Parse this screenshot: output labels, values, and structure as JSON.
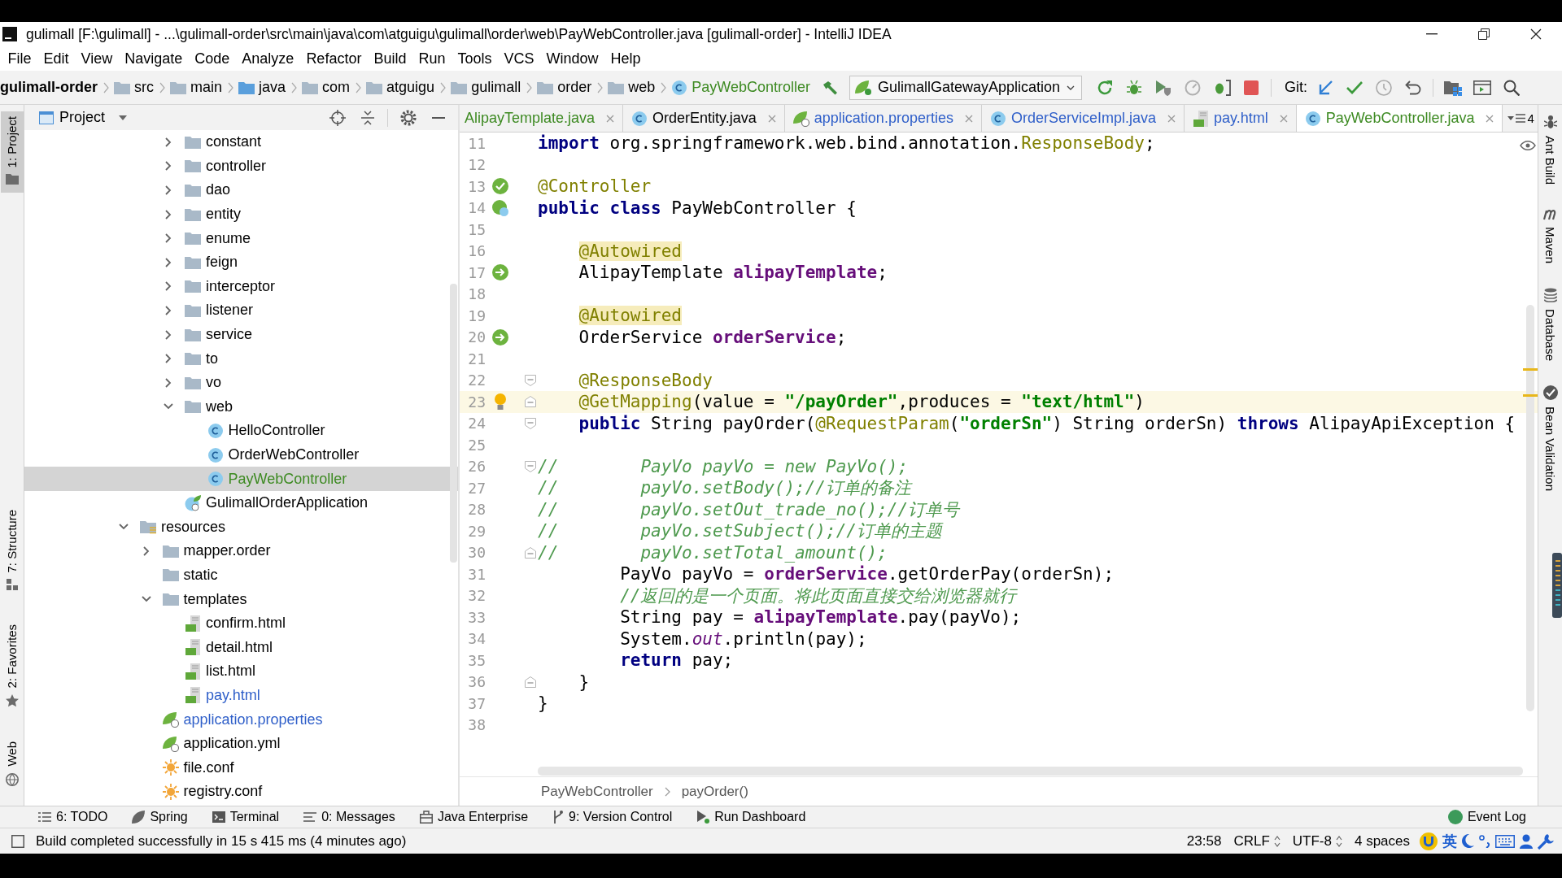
{
  "window": {
    "title": "gulimall [F:\\gulimall] - ...\\gulimall-order\\src\\main\\java\\com\\atguigu\\gulimall\\order\\web\\PayWebController.java [gulimall-order] - IntelliJ IDEA"
  },
  "menu": [
    "File",
    "Edit",
    "View",
    "Navigate",
    "Code",
    "Analyze",
    "Refactor",
    "Build",
    "Run",
    "Tools",
    "VCS",
    "Window",
    "Help"
  ],
  "nav_bar": {
    "breadcrumbs": [
      {
        "label": "gulimall-order",
        "kind": "module",
        "color": "#000000"
      },
      {
        "label": "src",
        "kind": "folder",
        "color": "#000000"
      },
      {
        "label": "main",
        "kind": "folder",
        "color": "#000000"
      },
      {
        "label": "java",
        "kind": "source_root",
        "color": "#000000"
      },
      {
        "label": "com",
        "kind": "package",
        "color": "#000000"
      },
      {
        "label": "atguigu",
        "kind": "package",
        "color": "#000000"
      },
      {
        "label": "gulimall",
        "kind": "package",
        "color": "#000000"
      },
      {
        "label": "order",
        "kind": "package",
        "color": "#000000"
      },
      {
        "label": "web",
        "kind": "package",
        "color": "#000000"
      },
      {
        "label": "PayWebController",
        "kind": "class",
        "color": "#3d8a22"
      }
    ],
    "run_config": "GulimallGatewayApplication",
    "vcs_label": "Git:"
  },
  "left_stripe": {
    "top": [
      {
        "label": "1: Project",
        "kind": "project",
        "selected": true
      }
    ],
    "bottom": [
      {
        "label": "7: Structure",
        "kind": "structure",
        "selected": false
      },
      {
        "label": "2: Favorites",
        "kind": "favorites",
        "selected": false
      },
      {
        "label": "Web",
        "kind": "web",
        "selected": false
      }
    ]
  },
  "project_panel": {
    "title": "Project",
    "package_contents": [
      {
        "label": "constant",
        "kind": "package",
        "expanded": false,
        "selected": false,
        "color": "#000000"
      },
      {
        "label": "controller",
        "kind": "package",
        "expanded": false,
        "selected": false,
        "color": "#000000"
      },
      {
        "label": "dao",
        "kind": "package",
        "expanded": false,
        "selected": false,
        "color": "#000000"
      },
      {
        "label": "entity",
        "kind": "package",
        "expanded": false,
        "selected": false,
        "color": "#000000"
      },
      {
        "label": "enume",
        "kind": "package",
        "expanded": false,
        "selected": false,
        "color": "#000000"
      },
      {
        "label": "feign",
        "kind": "package",
        "expanded": false,
        "selected": false,
        "color": "#000000"
      },
      {
        "label": "interceptor",
        "kind": "package",
        "expanded": false,
        "selected": false,
        "color": "#000000"
      },
      {
        "label": "listener",
        "kind": "package",
        "expanded": false,
        "selected": false,
        "color": "#000000"
      },
      {
        "label": "service",
        "kind": "package",
        "expanded": false,
        "selected": false,
        "color": "#000000"
      },
      {
        "label": "to",
        "kind": "package",
        "expanded": false,
        "selected": false,
        "color": "#000000"
      },
      {
        "label": "vo",
        "kind": "package",
        "expanded": false,
        "selected": false,
        "color": "#000000"
      },
      {
        "label": "web",
        "kind": "package",
        "expanded": true,
        "selected": false,
        "color": "#000000",
        "children": [
          {
            "label": "HelloController",
            "kind": "class",
            "selected": false,
            "color": "#000000"
          },
          {
            "label": "OrderWebController",
            "kind": "class",
            "selected": false,
            "color": "#000000"
          },
          {
            "label": "PayWebController",
            "kind": "class",
            "selected": true,
            "color": "#3d8a22"
          }
        ]
      },
      {
        "label": "GulimallOrderApplication",
        "kind": "spring_app",
        "selected": false,
        "color": "#000000"
      }
    ],
    "items": [
      {
        "label": "resources",
        "kind": "resources_root",
        "expanded": true,
        "selected": false,
        "color": "#000000",
        "children": [
          {
            "label": "mapper.order",
            "kind": "folder",
            "expanded": false,
            "selected": false,
            "color": "#000000"
          },
          {
            "label": "static",
            "kind": "folder",
            "selected": false,
            "color": "#000000"
          },
          {
            "label": "templates",
            "kind": "folder",
            "expanded": true,
            "selected": false,
            "color": "#000000",
            "children": [
              {
                "label": "confirm.html",
                "kind": "html",
                "selected": false,
                "color": "#000000"
              },
              {
                "label": "detail.html",
                "kind": "html",
                "selected": false,
                "color": "#000000"
              },
              {
                "label": "list.html",
                "kind": "html",
                "selected": false,
                "color": "#000000"
              },
              {
                "label": "pay.html",
                "kind": "html",
                "selected": false,
                "color": "#2f5fc9"
              }
            ]
          },
          {
            "label": "application.properties",
            "kind": "spring_config",
            "selected": false,
            "color": "#2f5fc9"
          },
          {
            "label": "application.yml",
            "kind": "spring_config",
            "selected": false,
            "color": "#000000"
          },
          {
            "label": "file.conf",
            "kind": "conf",
            "selected": false,
            "color": "#000000"
          },
          {
            "label": "registry.conf",
            "kind": "conf",
            "selected": false,
            "color": "#000000"
          }
        ]
      }
    ]
  },
  "editor": {
    "tabs": [
      {
        "label": "AlipayTemplate.java",
        "kind": "clipped",
        "selected": false,
        "color": "#3d8a22"
      },
      {
        "label": "OrderEntity.java",
        "kind": "class",
        "selected": false,
        "color": "#000000"
      },
      {
        "label": "application.properties",
        "kind": "spring_config",
        "selected": false,
        "color": "#2f5fc9"
      },
      {
        "label": "OrderServiceImpl.java",
        "kind": "class",
        "selected": false,
        "color": "#2f5fc9"
      },
      {
        "label": "pay.html",
        "kind": "html",
        "selected": false,
        "color": "#2f5fc9"
      },
      {
        "label": "PayWebController.java",
        "kind": "class",
        "selected": true,
        "color": "#3d8a22"
      }
    ],
    "hidden_tab_count": "4",
    "lines": [
      {
        "number": "11",
        "current": false,
        "tokens": [
          {
            "text": "import",
            "kind": "keyword"
          },
          {
            "text": " org.springframework.web.bind.annotation.",
            "kind": "plain"
          },
          {
            "text": "ResponseBody",
            "kind": "annotation"
          },
          {
            "text": ";",
            "kind": "plain"
          }
        ]
      },
      {
        "number": "12",
        "current": false
      },
      {
        "number": "13",
        "current": false,
        "marker": {
          "kind": "bean_check"
        },
        "tokens": [
          {
            "text": "@Controller",
            "kind": "annotation"
          }
        ]
      },
      {
        "number": "14",
        "current": false,
        "marker": {
          "kind": "bean_class"
        },
        "tokens": [
          {
            "text": "public class",
            "kind": "keyword"
          },
          {
            "text": " PayWebController {",
            "kind": "plain"
          }
        ]
      },
      {
        "number": "15",
        "current": false
      },
      {
        "number": "16",
        "current": false,
        "tokens": [
          {
            "text": "    @Autowired",
            "kind": "annotation_warning"
          }
        ]
      },
      {
        "number": "17",
        "current": false,
        "marker": {
          "kind": "autowired"
        },
        "tokens": [
          {
            "text": "    AlipayTemplate ",
            "kind": "plain"
          },
          {
            "text": "alipayTemplate",
            "kind": "field"
          },
          {
            "text": ";",
            "kind": "plain"
          }
        ]
      },
      {
        "number": "18",
        "current": false
      },
      {
        "number": "19",
        "current": false,
        "tokens": [
          {
            "text": "    @Autowired",
            "kind": "annotation_warning"
          }
        ]
      },
      {
        "number": "20",
        "current": false,
        "marker": {
          "kind": "autowired"
        },
        "tokens": [
          {
            "text": "    OrderService ",
            "kind": "plain"
          },
          {
            "text": "orderService",
            "kind": "field"
          },
          {
            "text": ";",
            "kind": "plain"
          }
        ]
      },
      {
        "number": "21",
        "current": false
      },
      {
        "number": "22",
        "current": false,
        "fold": {
          "kind": "start"
        },
        "tokens": [
          {
            "text": "    @ResponseBody",
            "kind": "annotation"
          }
        ]
      },
      {
        "number": "23",
        "current": true,
        "marker": {
          "kind": "bulb"
        },
        "fold": {
          "kind": "end"
        },
        "tokens": [
          {
            "text": "    @GetMapping",
            "kind": "annotation"
          },
          {
            "text": "(value = ",
            "kind": "plain"
          },
          {
            "text": "\"/payOrder\"",
            "kind": "string"
          },
          {
            "text": ",produces = ",
            "kind": "plain"
          },
          {
            "text": "\"text/html\"",
            "kind": "string"
          },
          {
            "text": ")",
            "kind": "plain"
          }
        ]
      },
      {
        "number": "24",
        "current": false,
        "fold": {
          "kind": "start"
        },
        "tokens": [
          {
            "text": "    public",
            "kind": "keyword"
          },
          {
            "text": " String payOrder(",
            "kind": "plain"
          },
          {
            "text": "@RequestParam",
            "kind": "annotation"
          },
          {
            "text": "(",
            "kind": "plain"
          },
          {
            "text": "\"orderSn\"",
            "kind": "string"
          },
          {
            "text": ") String orderSn) ",
            "kind": "plain"
          },
          {
            "text": "throws",
            "kind": "keyword"
          },
          {
            "text": " AlipayApiException {",
            "kind": "plain"
          }
        ]
      },
      {
        "number": "25",
        "current": false
      },
      {
        "number": "26",
        "current": false,
        "fold": {
          "kind": "start"
        },
        "tokens": [
          {
            "text": "//        PayVo payVo = new PayVo();",
            "kind": "comment"
          }
        ]
      },
      {
        "number": "27",
        "current": false,
        "tokens": [
          {
            "text": "//        payVo.setBody();//订单的备注",
            "kind": "comment"
          }
        ]
      },
      {
        "number": "28",
        "current": false,
        "tokens": [
          {
            "text": "//        payVo.setOut_trade_no();//订单号",
            "kind": "comment"
          }
        ]
      },
      {
        "number": "29",
        "current": false,
        "tokens": [
          {
            "text": "//        payVo.setSubject();//订单的主题",
            "kind": "comment"
          }
        ]
      },
      {
        "number": "30",
        "current": false,
        "fold": {
          "kind": "end"
        },
        "tokens": [
          {
            "text": "//        payVo.setTotal_amount();",
            "kind": "comment"
          }
        ]
      },
      {
        "number": "31",
        "current": false,
        "tokens": [
          {
            "text": "        PayVo payVo = ",
            "kind": "plain"
          },
          {
            "text": "orderService",
            "kind": "field"
          },
          {
            "text": ".getOrderPay(orderSn);",
            "kind": "plain"
          }
        ]
      },
      {
        "number": "32",
        "current": false,
        "tokens": [
          {
            "text": "        //返回的是一个页面。将此页面直接交给浏览器就行",
            "kind": "comment"
          }
        ]
      },
      {
        "number": "33",
        "current": false,
        "tokens": [
          {
            "text": "        String pay = ",
            "kind": "plain"
          },
          {
            "text": "alipayTemplate",
            "kind": "field"
          },
          {
            "text": ".pay(payVo);",
            "kind": "plain"
          }
        ]
      },
      {
        "number": "34",
        "current": false,
        "tokens": [
          {
            "text": "        System.",
            "kind": "plain"
          },
          {
            "text": "out",
            "kind": "static_field"
          },
          {
            "text": ".println(pay);",
            "kind": "plain"
          }
        ]
      },
      {
        "number": "35",
        "current": false,
        "tokens": [
          {
            "text": "        return",
            "kind": "keyword"
          },
          {
            "text": " pay;",
            "kind": "plain"
          }
        ]
      },
      {
        "number": "36",
        "current": false,
        "fold": {
          "kind": "end"
        },
        "tokens": [
          {
            "text": "    }",
            "kind": "plain"
          }
        ]
      },
      {
        "number": "37",
        "current": false,
        "tokens": [
          {
            "text": "}",
            "kind": "plain"
          }
        ]
      },
      {
        "number": "38",
        "current": false
      }
    ],
    "breadcrumbs": [
      "PayWebController",
      "payOrder()"
    ]
  },
  "right_stripe": [
    {
      "label": "Ant Build",
      "kind": "ant"
    },
    {
      "label": "Maven",
      "kind": "maven"
    },
    {
      "label": "Database",
      "kind": "database"
    },
    {
      "label": "Bean Validation",
      "kind": "bean_validation"
    }
  ],
  "tool_windows": [
    {
      "label": "6: TODO",
      "kind": "todo"
    },
    {
      "label": "Spring",
      "kind": "spring"
    },
    {
      "label": "Terminal",
      "kind": "terminal"
    },
    {
      "label": "0: Messages",
      "kind": "messages"
    },
    {
      "label": "Java Enterprise",
      "kind": "java_enterprise"
    },
    {
      "label": "9: Version Control",
      "kind": "version_control"
    },
    {
      "label": "Run Dashboard",
      "kind": "run_dashboard"
    }
  ],
  "event_log": "Event Log",
  "status_bar": {
    "message": "Build completed successfully in 15 s 415 ms (4 minutes ago)",
    "caret_position": "23:58",
    "line_separator": "CRLF",
    "encoding": "UTF-8",
    "indent": "4 spaces",
    "ime_mode": "英"
  }
}
